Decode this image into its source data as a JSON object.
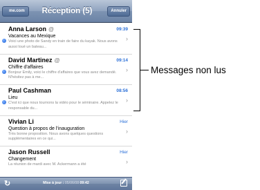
{
  "navbar": {
    "back_label": "me.com",
    "title": "Réception (5)",
    "edit_label": "Annuler"
  },
  "messages": [
    {
      "sender": "Anna Larson",
      "attachment": "@",
      "time": "09:39",
      "subject": "Vacances au Mexique",
      "preview": "Voici une photo de Sandy en train de faire du kayak. Nous avons aussi loué un bateau...",
      "unread": true
    },
    {
      "sender": "David Martinez",
      "attachment": "@",
      "time": "09:14",
      "subject": "Chiffre d'affaires",
      "preview": "Bonjour Emily, voici le chiffre d'affaires que vous avez demandé. N'hésitez pas à me...",
      "unread": true
    },
    {
      "sender": "Paul Cashman",
      "attachment": "",
      "time": "08:56",
      "subject": "Lieu",
      "preview": "C'est ici que nous tournons la vidéo pour le séminaire. Appelez le responsable du...",
      "unread": true
    },
    {
      "sender": "Vivian Li",
      "attachment": "",
      "time": "Hier",
      "subject": "Question à propos de l'inauguration",
      "preview": "Très bonne proposition. Nous avons quelques questions supplémentaires en ce qui...",
      "unread": false
    },
    {
      "sender": "Jason Russell",
      "attachment": "",
      "time": "Hier",
      "subject": "Changement",
      "preview": "La réunion de mardi avec M. Ackermann a été",
      "unread": false
    }
  ],
  "toolbar": {
    "status_prefix": "Mise à jour :",
    "status_date": "05/06/08",
    "status_time": "09:42"
  },
  "callout": {
    "label": "Messages non lus"
  },
  "icons": {
    "refresh": "refresh-icon",
    "compose": "compose-icon",
    "chevron": "chevron-right-icon",
    "attachment": "paperclip-icon"
  },
  "colors": {
    "accent": "#2a6fd8",
    "unread_dot": "#1a5fd6",
    "navbar": "#7d93b2"
  }
}
